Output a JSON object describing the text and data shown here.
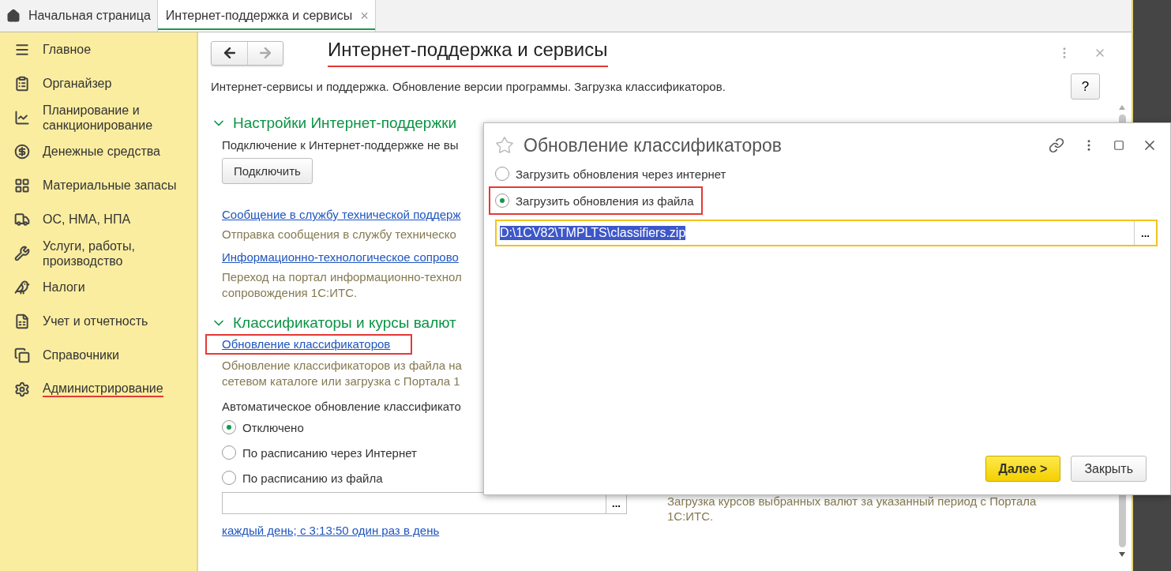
{
  "tabs": [
    {
      "label": "Начальная страница",
      "kind": "home",
      "selected": false
    },
    {
      "label": "Интернет-поддержка и сервисы",
      "kind": "page",
      "selected": true,
      "close": "×"
    }
  ],
  "sidebar": {
    "items": [
      {
        "label": "Главное",
        "annotated": false
      },
      {
        "label": "Органайзер",
        "annotated": false
      },
      {
        "label": "Планирование и санкционирование",
        "annotated": false
      },
      {
        "label": "Денежные средства",
        "annotated": false
      },
      {
        "label": "Материальные запасы",
        "annotated": false
      },
      {
        "label": "ОС, НМА, НПА",
        "annotated": false
      },
      {
        "label": "Услуги, работы, производство",
        "annotated": false
      },
      {
        "label": "Налоги",
        "annotated": false
      },
      {
        "label": "Учет и отчетность",
        "annotated": false
      },
      {
        "label": "Справочники",
        "annotated": false
      },
      {
        "label": "Администрирование",
        "annotated": true
      }
    ]
  },
  "page": {
    "title": "Интернет-поддержка и сервисы",
    "title_annotated": true,
    "description": "Интернет-сервисы и поддержка. Обновление версии программы. Загрузка классификаторов.",
    "help": "?",
    "sections": [
      {
        "heading": "Настройки Интернет-поддержки",
        "expanded": true,
        "text": "Подключение к Интернет-поддержке не вы",
        "button": "Подключить",
        "links": [
          {
            "label": "Сообщение в службу технической поддерж",
            "annotated": false,
            "description": [
              "Отправка сообщения в службу техническо"
            ]
          },
          {
            "label": "Информационно-технологическое сопрово",
            "annotated": false,
            "description": [
              "Переход на портал информационно-технол",
              "сопровождения 1С:ИТС."
            ]
          }
        ]
      },
      {
        "heading": "Классификаторы и курсы валют",
        "expanded": true,
        "links": [
          {
            "label": "Обновление классификаторов",
            "annotated": true,
            "description": [
              "Обновление классификаторов из файла на",
              "сетевом каталоге или загрузка с Портала 1"
            ]
          }
        ],
        "auto_label": "Автоматическое обновление классификато",
        "options": [
          {
            "label": "Отключено",
            "selected": true
          },
          {
            "label": "По расписанию через Интернет",
            "selected": false
          },
          {
            "label": "По расписанию из файла",
            "selected": false
          }
        ],
        "browse": "...",
        "schedule": "каждый день; с 3:13:50 один раз в день",
        "side_text": "Загрузка курсов выбранных валют за указанный период с Портала 1С:ИТС."
      }
    ]
  },
  "dialog": {
    "title": "Обновление классификаторов",
    "options": [
      {
        "label": "Загрузить обновления через интернет",
        "selected": false,
        "annotated": false
      },
      {
        "label": "Загрузить обновления из файла",
        "selected": true,
        "annotated": true
      }
    ],
    "path": "D:\\1CV82\\TMPLTS\\classifiers.zip",
    "browse": "...",
    "buttons": [
      {
        "label": "Далее >",
        "kind": "primary"
      },
      {
        "label": "Закрыть",
        "kind": "default"
      }
    ]
  }
}
